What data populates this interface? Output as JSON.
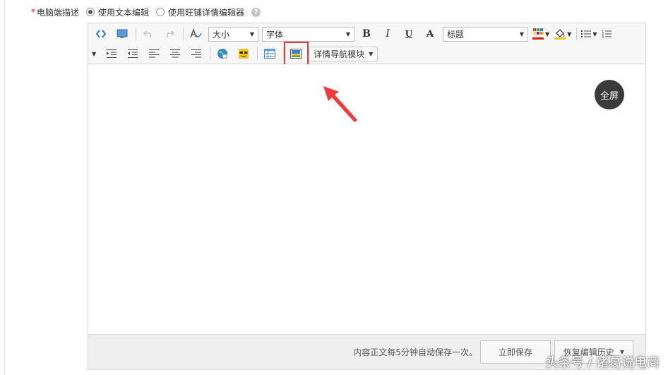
{
  "field": {
    "required_mark": "*",
    "label": "电脑端描述",
    "options": [
      {
        "label": "使用文本编辑",
        "checked": true
      },
      {
        "label": "使用旺铺详情编辑器",
        "checked": false
      }
    ],
    "help": "?"
  },
  "toolbar": {
    "size_select": "大小",
    "font_select": "字体",
    "bold": "B",
    "italic": "I",
    "underline": "U",
    "strike": "A",
    "heading_select": "标题",
    "module_button": "详情导航模块",
    "font_color": "#d81e06",
    "bg_color": "#f4c522",
    "icons": [
      "source-icon",
      "preview-icon",
      "undo-icon",
      "redo-icon",
      "clear-format-icon",
      "font-color-icon",
      "highlight-color-icon",
      "unordered-list-icon",
      "ordered-list-icon",
      "indent-icon",
      "outdent-icon",
      "align-left-icon",
      "align-center-icon",
      "align-right-icon",
      "link-icon",
      "emoticon-icon",
      "table-icon",
      "image-icon"
    ]
  },
  "editor": {
    "fullscreen": "全屏"
  },
  "footer": {
    "autosave_note": "内容正文每5分钟自动保存一次。",
    "save_now": "立即保存",
    "history": "恢复编辑历史"
  },
  "watermark": "头条号 / 诸葛说电商"
}
